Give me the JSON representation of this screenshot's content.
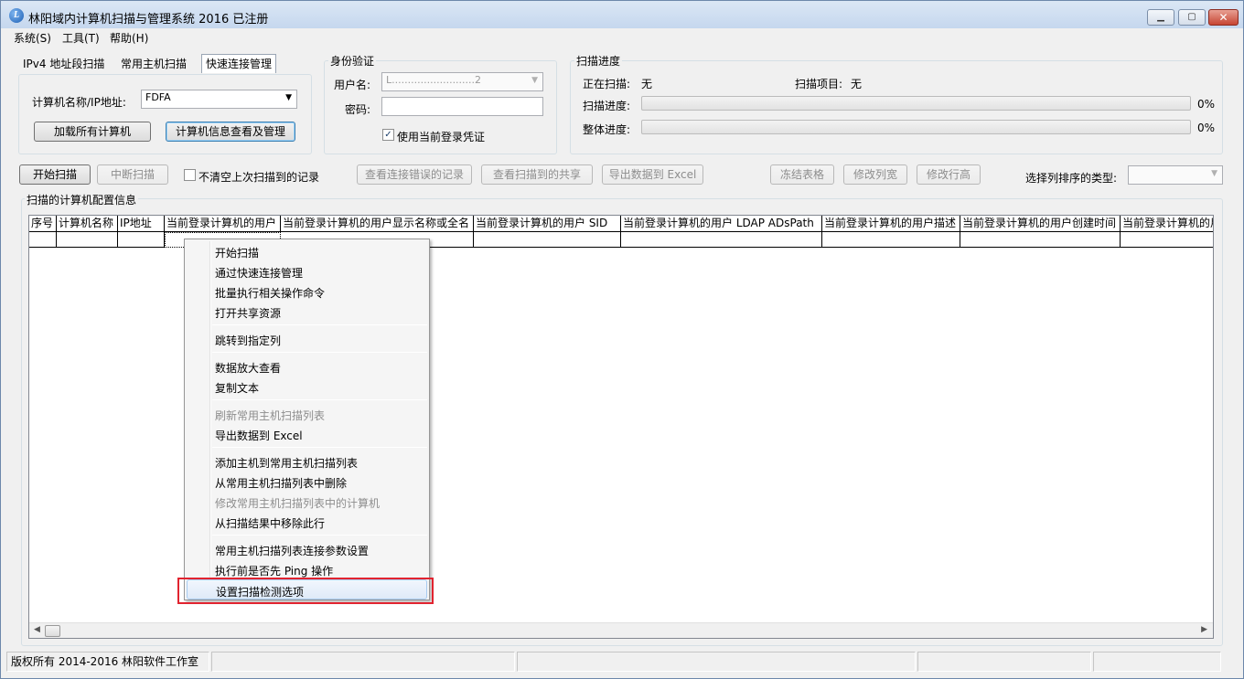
{
  "window": {
    "title": "林阳域内计算机扫描与管理系统 2016 已注册"
  },
  "menu": [
    "系统(S)",
    "工具(T)",
    "帮助(H)"
  ],
  "tabs": [
    "IPv4 地址段扫描",
    "常用主机扫描",
    "快速连接管理"
  ],
  "left_panel": {
    "computer_label": "计算机名称/IP地址:",
    "computer_value": "FDFA",
    "load_button": "加载所有计算机",
    "manage_button": "计算机信息查看及管理"
  },
  "auth": {
    "title": "身份验证",
    "user_label": "用户名:",
    "user_value": "L..........................2",
    "password_label": "密码:",
    "password_value": "",
    "use_current_label": "使用当前登录凭证",
    "use_current_checked": "✓"
  },
  "progress": {
    "title": "扫描进度",
    "scanning_label": "正在扫描:",
    "scanning_value": "无",
    "item_label": "扫描项目:",
    "item_value": "无",
    "scan_progress_label": "扫描进度:",
    "scan_progress_pct": "0%",
    "scan_progress_value": 0,
    "overall_label": "整体进度:",
    "overall_pct": "0%",
    "overall_value": 0
  },
  "toolbar": {
    "start": "开始扫描",
    "stop": "中断扫描",
    "keep_records": "不清空上次扫描到的记录",
    "view_errors": "查看连接错误的记录",
    "view_shares": "查看扫描到的共享",
    "export_excel": "导出数据到 Excel",
    "freeze": "冻结表格",
    "col_width": "修改列宽",
    "row_height": "修改行高",
    "sort_label": "选择列排序的类型:"
  },
  "grid": {
    "title": "扫描的计算机配置信息",
    "columns": [
      "序号",
      "计算机名称",
      "IP地址",
      "当前登录计算机的用户",
      "当前登录计算机的用户显示名称或全名",
      "当前登录计算机的用户 SID",
      "当前登录计算机的用户 LDAP ADsPath",
      "当前登录计算机的用户描述",
      "当前登录计算机的用户创建时间",
      "当前登录计算机的用户"
    ]
  },
  "context_menu": [
    {
      "label": "开始扫描",
      "disabled": false
    },
    {
      "label": "通过快速连接管理",
      "disabled": false
    },
    {
      "label": "批量执行相关操作命令",
      "disabled": false
    },
    {
      "label": "打开共享资源",
      "disabled": false
    },
    {
      "sep": true
    },
    {
      "label": "跳转到指定列",
      "disabled": false
    },
    {
      "sep": true
    },
    {
      "label": "数据放大查看",
      "disabled": false
    },
    {
      "label": "复制文本",
      "disabled": false
    },
    {
      "sep": true
    },
    {
      "label": "刷新常用主机扫描列表",
      "disabled": true
    },
    {
      "label": "导出数据到 Excel",
      "disabled": false
    },
    {
      "sep": true
    },
    {
      "label": "添加主机到常用主机扫描列表",
      "disabled": false
    },
    {
      "label": "从常用主机扫描列表中删除",
      "disabled": false
    },
    {
      "label": "修改常用主机扫描列表中的计算机",
      "disabled": true
    },
    {
      "label": "从扫描结果中移除此行",
      "disabled": false
    },
    {
      "sep": true
    },
    {
      "label": "常用主机扫描列表连接参数设置",
      "disabled": false
    },
    {
      "label": "执行前是否先 Ping 操作",
      "disabled": false
    },
    {
      "label": "设置扫描检测选项",
      "disabled": false,
      "hover": true
    }
  ],
  "statusbar": {
    "copyright": "版权所有 2014-2016 林阳软件工作室"
  }
}
